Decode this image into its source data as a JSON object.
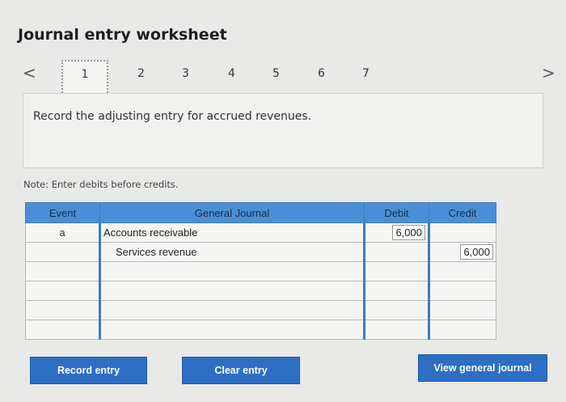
{
  "header": {
    "title": "Journal entry worksheet"
  },
  "nav": {
    "prev_icon": "chevron-left-icon",
    "next_icon": "chevron-right-icon",
    "prev_glyph": "<",
    "next_glyph": ">",
    "steps": [
      "1",
      "2",
      "3",
      "4",
      "5",
      "6",
      "7"
    ],
    "active_step": "1"
  },
  "prompt": {
    "text": "Record the adjusting entry for accrued revenues."
  },
  "note": {
    "text": "Note: Enter debits before credits."
  },
  "journal": {
    "columns": {
      "event": "Event",
      "general_journal": "General Journal",
      "debit": "Debit",
      "credit": "Credit"
    },
    "rows": [
      {
        "event": "a",
        "account": "Accounts receivable",
        "debit": "6,000",
        "credit": ""
      },
      {
        "event": "",
        "account": "Services revenue",
        "debit": "",
        "credit": "6,000"
      },
      {
        "event": "",
        "account": "",
        "debit": "",
        "credit": ""
      },
      {
        "event": "",
        "account": "",
        "debit": "",
        "credit": ""
      },
      {
        "event": "",
        "account": "",
        "debit": "",
        "credit": ""
      },
      {
        "event": "",
        "account": "",
        "debit": "",
        "credit": ""
      }
    ]
  },
  "buttons": {
    "record": "Record entry",
    "clear": "Clear entry",
    "view": "View general journal"
  },
  "colors": {
    "accent": "#2c6fc4",
    "header_bg": "#4a8fd6"
  }
}
